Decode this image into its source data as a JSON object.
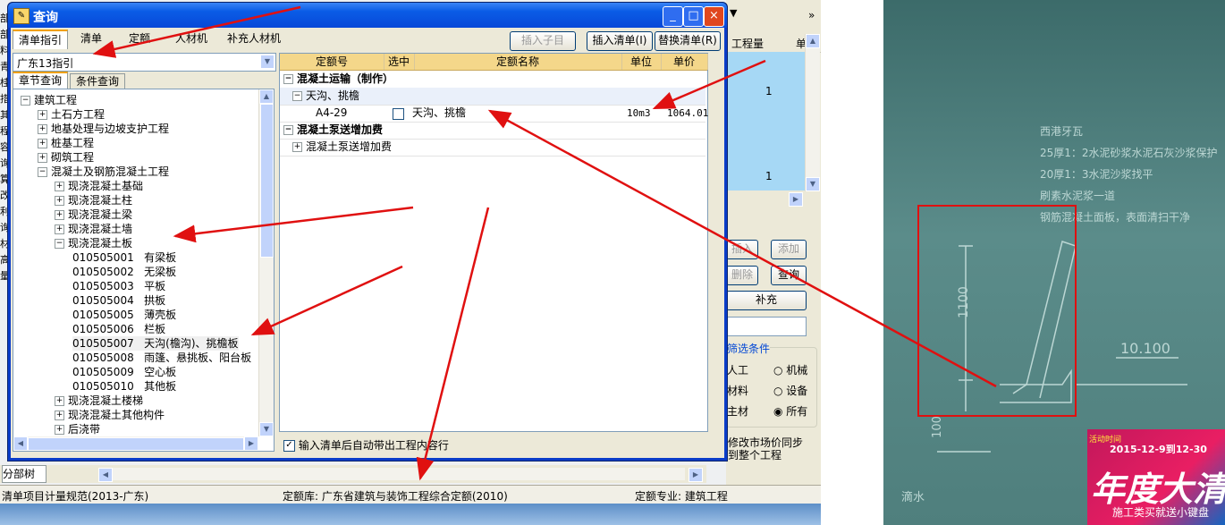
{
  "dialog": {
    "title": "查询",
    "min_label": "_",
    "max_label": "□",
    "close_label": "×"
  },
  "tabs": [
    "清单指引",
    "清单",
    "定额",
    "人材机",
    "补充人材机"
  ],
  "buttons": {
    "insert_child": "插入子目",
    "insert_list": "插入清单(I)",
    "replace_list": "替换清单(R)"
  },
  "guide_select": {
    "value": "广东13指引"
  },
  "subtabs": [
    "章节查询",
    "条件查询"
  ],
  "tree": [
    {
      "level": 0,
      "sign": "-",
      "label": "建筑工程"
    },
    {
      "level": 1,
      "sign": "+",
      "label": "土石方工程"
    },
    {
      "level": 1,
      "sign": "+",
      "label": "地基处理与边坡支护工程"
    },
    {
      "level": 1,
      "sign": "+",
      "label": "桩基工程"
    },
    {
      "level": 1,
      "sign": "+",
      "label": "砌筑工程"
    },
    {
      "level": 1,
      "sign": "-",
      "label": "混凝土及钢筋混凝土工程"
    },
    {
      "level": 2,
      "sign": "+",
      "label": "现浇混凝土基础"
    },
    {
      "level": 2,
      "sign": "+",
      "label": "现浇混凝土柱"
    },
    {
      "level": 2,
      "sign": "+",
      "label": "现浇混凝土梁"
    },
    {
      "level": 2,
      "sign": "+",
      "label": "现浇混凝土墙"
    },
    {
      "level": 2,
      "sign": "-",
      "label": "现浇混凝土板"
    },
    {
      "level": 3,
      "sign": "",
      "label": "010505001   有梁板"
    },
    {
      "level": 3,
      "sign": "",
      "label": "010505002   无梁板"
    },
    {
      "level": 3,
      "sign": "",
      "label": "010505003   平板"
    },
    {
      "level": 3,
      "sign": "",
      "label": "010505004   拱板"
    },
    {
      "level": 3,
      "sign": "",
      "label": "010505005   薄壳板"
    },
    {
      "level": 3,
      "sign": "",
      "label": "010505006   栏板"
    },
    {
      "level": 3,
      "sign": "",
      "label": "010505007   天沟(檐沟)、挑檐板",
      "selected": true
    },
    {
      "level": 3,
      "sign": "",
      "label": "010505008   雨篷、悬挑板、阳台板"
    },
    {
      "level": 3,
      "sign": "",
      "label": "010505009   空心板"
    },
    {
      "level": 3,
      "sign": "",
      "label": "010505010   其他板"
    },
    {
      "level": 2,
      "sign": "+",
      "label": "现浇混凝土楼梯"
    },
    {
      "level": 2,
      "sign": "+",
      "label": "现浇混凝土其他构件"
    },
    {
      "level": 2,
      "sign": "+",
      "label": "后浇带"
    }
  ],
  "grid": {
    "headers": [
      "定额号",
      "选中",
      "定额名称",
      "单位",
      "单价"
    ],
    "group1": "混凝土运输（制作）",
    "sub1": "天沟、挑檐",
    "row": {
      "code": "A4-29",
      "name": "天沟、挑檐",
      "unit": "10m3",
      "price": "1064.01"
    },
    "group2": "混凝土泵送增加费",
    "sub2": "混凝土泵送增加费"
  },
  "auto_check_label": "输入清单后自动带出工程内容行",
  "right_panel": {
    "header_qty": "工程量",
    "header_unit": "单",
    "row_values": [
      "1",
      "1"
    ],
    "btns": [
      "插入",
      "添加",
      "删除",
      "查询",
      "补充"
    ],
    "filter_title": "筛选条件",
    "options": [
      [
        "人工",
        "机械"
      ],
      [
        "材料",
        "设备"
      ],
      [
        "主材",
        "所有"
      ]
    ],
    "sync_text": [
      "修改市场价同步",
      "到整个工程"
    ]
  },
  "left_letters": [
    "部",
    "部",
    "料",
    "青",
    "桂",
    "措",
    "其",
    "程",
    "容",
    "询",
    "算",
    "改",
    "利",
    "询",
    "材",
    "高",
    "量"
  ],
  "statusbar": {
    "tab": "分部树",
    "rule": "清单项目计量规范(2013-广东)",
    "lib": "定额库: 广东省建筑与装饰工程综合定额(2010)",
    "major": "定额专业: 建筑工程"
  },
  "drawing": {
    "lines": [
      "西港牙瓦",
      "25厚1：2水泥砂浆水泥石灰沙浆保护",
      "20厚1：3水泥沙浆找平",
      "刷素水泥浆一道",
      "钢筋混凝土面板，表面清扫干净"
    ],
    "dim1": "1100",
    "dim2": "10.100",
    "dim3": "100",
    "label_water": "滴水"
  },
  "ad": {
    "date": "2015-12-9到12-30",
    "tag": "活动时间",
    "big": "年度大清",
    "sub": "施工类买就送小键盘"
  },
  "colors": {
    "title_blue": "#0a5ce6",
    "grid_header": "#f4d78a",
    "selection": "#f0f0f0",
    "arrow": "#e01010",
    "right_highlight": "#a6d8f5"
  }
}
